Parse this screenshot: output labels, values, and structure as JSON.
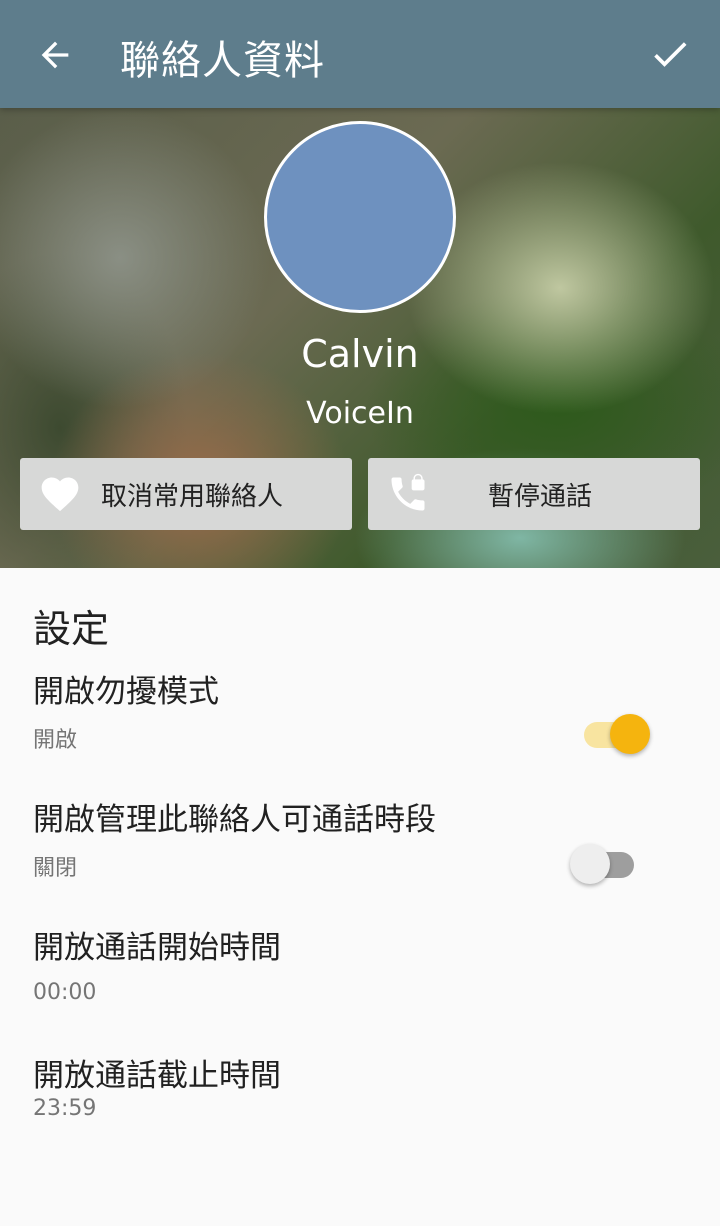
{
  "appbar": {
    "title": "聯絡人資料",
    "back_icon": "arrow-back-icon",
    "done_icon": "check-icon"
  },
  "contact": {
    "name": "Calvin",
    "source": "VoiceIn",
    "avatar_color": "#6e91bf"
  },
  "actions": [
    {
      "label": "取消常用聯絡人",
      "icon": "heart-icon"
    },
    {
      "label": "暫停通話",
      "icon": "phone-lock-icon"
    }
  ],
  "settings": {
    "header": "設定",
    "items": [
      {
        "title": "開啟勿擾模式",
        "summary": "開啟",
        "toggle": true
      },
      {
        "title": "開啟管理此聯絡人可通話時段",
        "summary": "關閉",
        "toggle": false
      },
      {
        "title": "開放通話開始時間",
        "summary": "00:00"
      },
      {
        "title": "開放通話截止時間",
        "summary": "23:59"
      }
    ]
  },
  "colors": {
    "appbar": "#5e7d8c",
    "accent": "#f5b40e",
    "button_bg": "#d7d8d7"
  }
}
